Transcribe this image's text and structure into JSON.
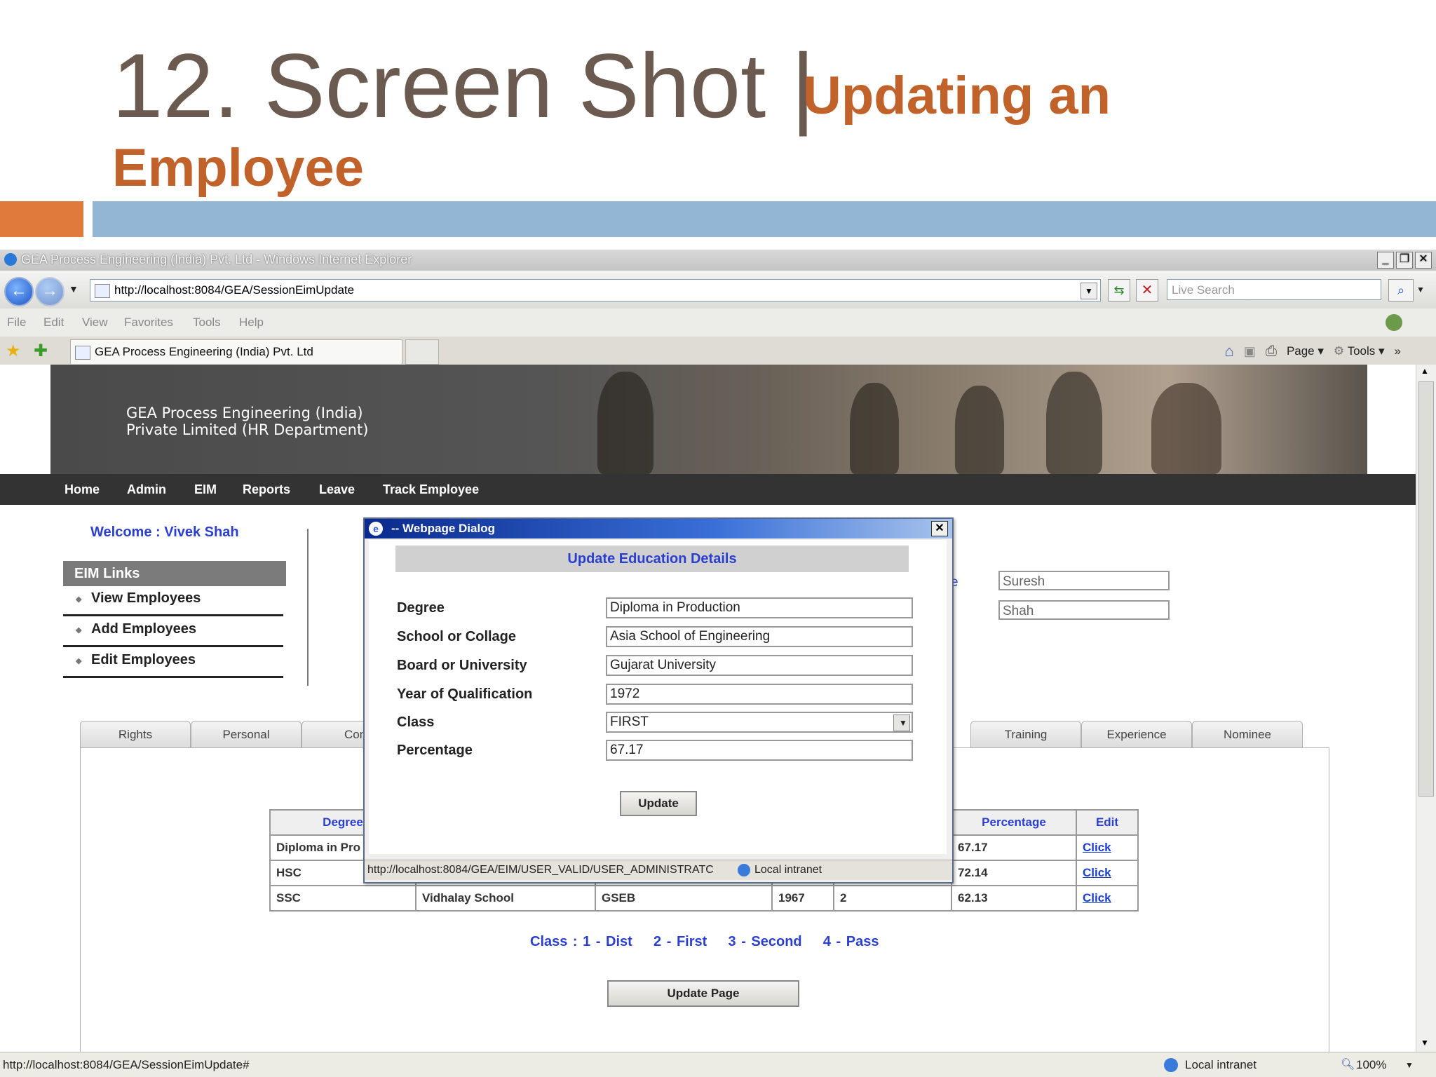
{
  "slide": {
    "title": "12. Screen Shot |",
    "subtitle_line1": "Updating an",
    "subtitle_line2": "Employee"
  },
  "window": {
    "title": "GEA Process Engineering (India) Pvt. Ltd - Windows Internet Explorer",
    "url": "http://localhost:8084/GEA/SessionEimUpdate",
    "search_placeholder": "Live Search",
    "menu": [
      "File",
      "Edit",
      "View",
      "Favorites",
      "Tools",
      "Help"
    ],
    "tab_title": "GEA Process Engineering (India) Pvt. Ltd",
    "cmd_page": "Page",
    "cmd_tools": "Tools"
  },
  "banner": {
    "company": "GEA Process Engineering (India)\nPrivate Limited (HR Department)"
  },
  "nav": [
    "Home",
    "Admin",
    "EIM",
    "Reports",
    "Leave",
    "Track Employee"
  ],
  "sidebar": {
    "welcome": "Welcome :  Vivek Shah",
    "header": "EIM Links",
    "items": [
      "View Employees",
      "Add Employees",
      "Edit Employees"
    ]
  },
  "form_bg": {
    "first_name": "Suresh",
    "last_name": "Shah",
    "label_fragment": "e"
  },
  "tabs": [
    "Rights",
    "Personal",
    "Cont",
    "Training",
    "Experience",
    "Nominee"
  ],
  "grid": {
    "headers": [
      "Degree",
      "Percentage",
      "Edit"
    ],
    "rows": [
      {
        "degree": "Diploma in Pro",
        "school": "",
        "board": "",
        "year": "",
        "class": "",
        "pct": "67.17",
        "edit": "Click"
      },
      {
        "degree": "HSC",
        "school": "",
        "board": "",
        "year": "",
        "class": "",
        "pct": "72.14",
        "edit": "Click"
      },
      {
        "degree": "SSC",
        "school": "Vidhalay School",
        "board": "GSEB",
        "year": "1967",
        "class": "2",
        "pct": "62.13",
        "edit": "Click"
      }
    ]
  },
  "legend": "Class : 1 - Dist    2 - First    3 - Second    4 - Pass",
  "update_page_label": "Update Page",
  "dialog": {
    "title": "-- Webpage Dialog",
    "heading": "Update Education Details",
    "labels": {
      "degree": "Degree",
      "school": "School or Collage",
      "board": "Board or University",
      "year": "Year of Qualification",
      "class": "Class",
      "percentage": "Percentage"
    },
    "values": {
      "degree": "Diploma in Production",
      "school": "Asia School of Engineering",
      "board": "Gujarat University",
      "year": "1972",
      "class": "FIRST",
      "percentage": "67.17"
    },
    "update_label": "Update",
    "status_url": "http://localhost:8084/GEA/EIM/USER_VALID/USER_ADMINISTRATC",
    "status_zone": "Local intranet"
  },
  "statusbar": {
    "url": "http://localhost:8084/GEA/SessionEimUpdate#",
    "zone": "Local intranet",
    "zoom": "100%"
  }
}
